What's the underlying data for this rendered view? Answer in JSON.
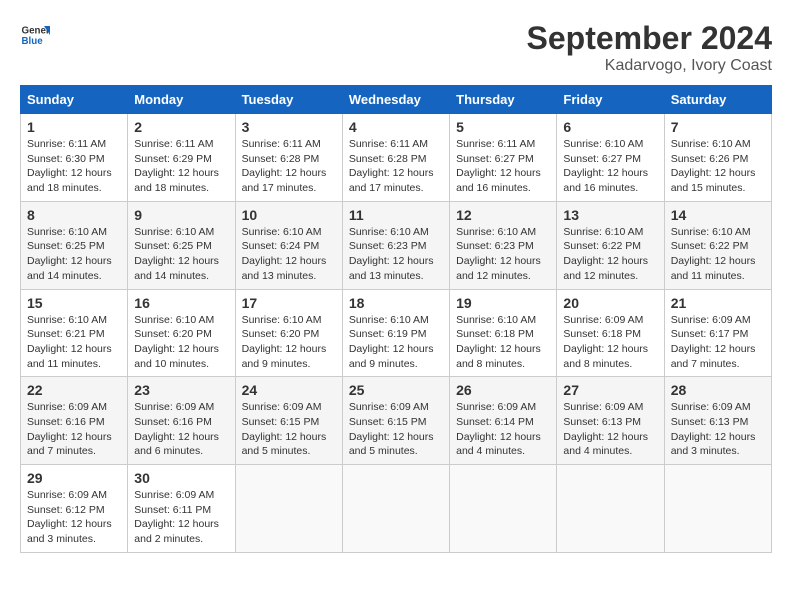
{
  "logo": {
    "text_general": "General",
    "text_blue": "Blue"
  },
  "title": {
    "month": "September 2024",
    "location": "Kadarvogo, Ivory Coast"
  },
  "calendar": {
    "headers": [
      "Sunday",
      "Monday",
      "Tuesday",
      "Wednesday",
      "Thursday",
      "Friday",
      "Saturday"
    ],
    "weeks": [
      [
        {
          "date": "",
          "info": ""
        },
        {
          "date": "2",
          "info": "Sunrise: 6:11 AM\nSunset: 6:29 PM\nDaylight: 12 hours and 18 minutes."
        },
        {
          "date": "3",
          "info": "Sunrise: 6:11 AM\nSunset: 6:28 PM\nDaylight: 12 hours and 17 minutes."
        },
        {
          "date": "4",
          "info": "Sunrise: 6:11 AM\nSunset: 6:28 PM\nDaylight: 12 hours and 17 minutes."
        },
        {
          "date": "5",
          "info": "Sunrise: 6:11 AM\nSunset: 6:27 PM\nDaylight: 12 hours and 16 minutes."
        },
        {
          "date": "6",
          "info": "Sunrise: 6:10 AM\nSunset: 6:27 PM\nDaylight: 12 hours and 16 minutes."
        },
        {
          "date": "7",
          "info": "Sunrise: 6:10 AM\nSunset: 6:26 PM\nDaylight: 12 hours and 15 minutes."
        }
      ],
      [
        {
          "date": "8",
          "info": "Sunrise: 6:10 AM\nSunset: 6:25 PM\nDaylight: 12 hours and 14 minutes."
        },
        {
          "date": "9",
          "info": "Sunrise: 6:10 AM\nSunset: 6:25 PM\nDaylight: 12 hours and 14 minutes."
        },
        {
          "date": "10",
          "info": "Sunrise: 6:10 AM\nSunset: 6:24 PM\nDaylight: 12 hours and 13 minutes."
        },
        {
          "date": "11",
          "info": "Sunrise: 6:10 AM\nSunset: 6:23 PM\nDaylight: 12 hours and 13 minutes."
        },
        {
          "date": "12",
          "info": "Sunrise: 6:10 AM\nSunset: 6:23 PM\nDaylight: 12 hours and 12 minutes."
        },
        {
          "date": "13",
          "info": "Sunrise: 6:10 AM\nSunset: 6:22 PM\nDaylight: 12 hours and 12 minutes."
        },
        {
          "date": "14",
          "info": "Sunrise: 6:10 AM\nSunset: 6:22 PM\nDaylight: 12 hours and 11 minutes."
        }
      ],
      [
        {
          "date": "15",
          "info": "Sunrise: 6:10 AM\nSunset: 6:21 PM\nDaylight: 12 hours and 11 minutes."
        },
        {
          "date": "16",
          "info": "Sunrise: 6:10 AM\nSunset: 6:20 PM\nDaylight: 12 hours and 10 minutes."
        },
        {
          "date": "17",
          "info": "Sunrise: 6:10 AM\nSunset: 6:20 PM\nDaylight: 12 hours and 9 minutes."
        },
        {
          "date": "18",
          "info": "Sunrise: 6:10 AM\nSunset: 6:19 PM\nDaylight: 12 hours and 9 minutes."
        },
        {
          "date": "19",
          "info": "Sunrise: 6:10 AM\nSunset: 6:18 PM\nDaylight: 12 hours and 8 minutes."
        },
        {
          "date": "20",
          "info": "Sunrise: 6:09 AM\nSunset: 6:18 PM\nDaylight: 12 hours and 8 minutes."
        },
        {
          "date": "21",
          "info": "Sunrise: 6:09 AM\nSunset: 6:17 PM\nDaylight: 12 hours and 7 minutes."
        }
      ],
      [
        {
          "date": "22",
          "info": "Sunrise: 6:09 AM\nSunset: 6:16 PM\nDaylight: 12 hours and 7 minutes."
        },
        {
          "date": "23",
          "info": "Sunrise: 6:09 AM\nSunset: 6:16 PM\nDaylight: 12 hours and 6 minutes."
        },
        {
          "date": "24",
          "info": "Sunrise: 6:09 AM\nSunset: 6:15 PM\nDaylight: 12 hours and 5 minutes."
        },
        {
          "date": "25",
          "info": "Sunrise: 6:09 AM\nSunset: 6:15 PM\nDaylight: 12 hours and 5 minutes."
        },
        {
          "date": "26",
          "info": "Sunrise: 6:09 AM\nSunset: 6:14 PM\nDaylight: 12 hours and 4 minutes."
        },
        {
          "date": "27",
          "info": "Sunrise: 6:09 AM\nSunset: 6:13 PM\nDaylight: 12 hours and 4 minutes."
        },
        {
          "date": "28",
          "info": "Sunrise: 6:09 AM\nSunset: 6:13 PM\nDaylight: 12 hours and 3 minutes."
        }
      ],
      [
        {
          "date": "29",
          "info": "Sunrise: 6:09 AM\nSunset: 6:12 PM\nDaylight: 12 hours and 3 minutes."
        },
        {
          "date": "30",
          "info": "Sunrise: 6:09 AM\nSunset: 6:11 PM\nDaylight: 12 hours and 2 minutes."
        },
        {
          "date": "",
          "info": ""
        },
        {
          "date": "",
          "info": ""
        },
        {
          "date": "",
          "info": ""
        },
        {
          "date": "",
          "info": ""
        },
        {
          "date": "",
          "info": ""
        }
      ]
    ],
    "week1_day1": {
      "date": "1",
      "info": "Sunrise: 6:11 AM\nSunset: 6:30 PM\nDaylight: 12 hours and 18 minutes."
    }
  }
}
